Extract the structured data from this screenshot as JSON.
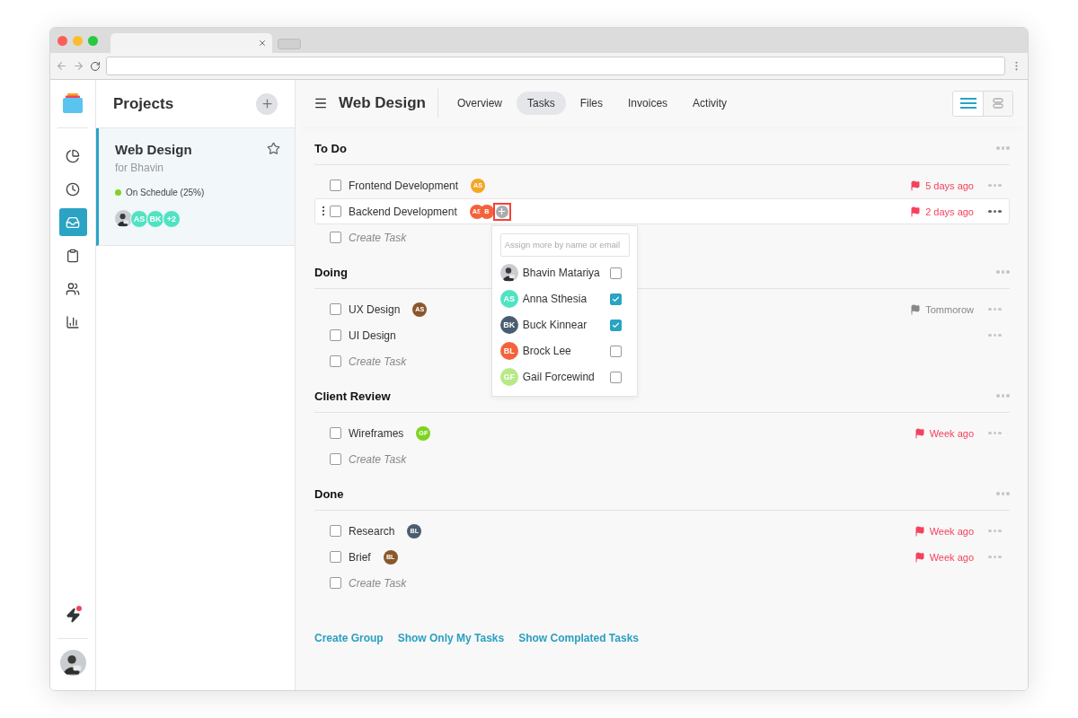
{
  "rail": {
    "items": [
      {
        "selected": false
      },
      {
        "selected": false
      },
      {
        "selected": true
      },
      {
        "selected": false
      },
      {
        "selected": false
      },
      {
        "selected": false
      }
    ],
    "has_notification": true
  },
  "projects": {
    "title": "Projects",
    "items": [
      {
        "name": "Web Design",
        "client": "for Bhavin",
        "status": "On Schedule (25%)",
        "color": "#7ed321",
        "selected": true,
        "starred": false,
        "members": [
          {
            "kind": "photo"
          },
          {
            "kind": "initials",
            "initials": "AS",
            "color": "#50e3c2"
          },
          {
            "kind": "initials",
            "initials": "BK",
            "color": "#50e3c2"
          },
          {
            "kind": "initials",
            "initials": "+2",
            "color": "#50e3c2"
          }
        ]
      }
    ]
  },
  "header": {
    "title": "Web Design",
    "tabs": [
      {
        "label": "Overview",
        "selected": false
      },
      {
        "label": "Tasks",
        "selected": true
      },
      {
        "label": "Files",
        "selected": false
      },
      {
        "label": "Invoices",
        "selected": false
      },
      {
        "label": "Activity",
        "selected": false
      }
    ],
    "view_modes": [
      {
        "selected": true
      },
      {
        "selected": false
      }
    ]
  },
  "groups": [
    {
      "title": "To Do",
      "tasks": [
        {
          "name": "Frontend Development",
          "checked": false,
          "hovered": false,
          "assignees": [
            {
              "initials": "AS",
              "color": "#f5a623"
            }
          ],
          "due": "5 days ago",
          "overdue": true
        },
        {
          "name": "Backend Development",
          "checked": false,
          "hovered": true,
          "assignees": [
            {
              "initials": "AS",
              "color": "#f4623a"
            },
            {
              "initials": "B",
              "color": "#f4623a"
            }
          ],
          "add_highlighted": true,
          "due": "2 days ago",
          "overdue": true
        }
      ],
      "create_task": {
        "placeholder": "Create Task",
        "checked": false
      }
    },
    {
      "title": "Doing",
      "tasks": [
        {
          "name": "UX Design",
          "checked": false,
          "hovered": false,
          "assignees": [
            {
              "initials": "AS",
              "color": "#8b572a"
            }
          ],
          "due": "Tommorow",
          "overdue": false
        },
        {
          "name": "UI Design",
          "checked": false,
          "hovered": false
        }
      ],
      "create_task": {
        "placeholder": "Create Task",
        "checked": false
      }
    },
    {
      "title": "Client Review",
      "tasks": [
        {
          "name": "Wireframes",
          "checked": false,
          "hovered": false,
          "assignees": [
            {
              "initials": "GF",
              "color": "#7ed321"
            }
          ],
          "due": "Week ago",
          "overdue": true
        }
      ],
      "create_task": {
        "placeholder": "Create Task",
        "checked": false
      }
    },
    {
      "title": "Done",
      "tasks": [
        {
          "name": "Research",
          "checked": false,
          "hovered": false,
          "assignees": [
            {
              "initials": "BL",
              "color": "#4a5d70"
            }
          ],
          "due": "Week ago",
          "overdue": true
        },
        {
          "name": "Brief",
          "checked": false,
          "hovered": false,
          "assignees": [
            {
              "initials": "BL",
              "color": "#8b572a"
            }
          ],
          "due": "Week ago",
          "overdue": true
        }
      ],
      "create_task": {
        "placeholder": "Create Task",
        "checked": false
      }
    }
  ],
  "assign_popup": {
    "placeholder": "Assign more by name or email",
    "people": [
      {
        "kind": "photo",
        "name": "Bhavin Matariya",
        "checked": false
      },
      {
        "kind": "initials",
        "initials": "AS",
        "color": "#50e3c2",
        "name": "Anna Sthesia",
        "checked": true
      },
      {
        "kind": "initials",
        "initials": "BK",
        "color": "#4a5d70",
        "name": "Buck Kinnear",
        "checked": true
      },
      {
        "kind": "initials",
        "initials": "BL",
        "color": "#f4623a",
        "name": "Brock Lee",
        "checked": false
      },
      {
        "kind": "initials",
        "initials": "GF",
        "color": "#b8e986",
        "name": "Gail Forcewind",
        "checked": false
      }
    ]
  },
  "footer_links": [
    "Create Group",
    "Show Only My Tasks",
    "Show Complated Tasks"
  ]
}
